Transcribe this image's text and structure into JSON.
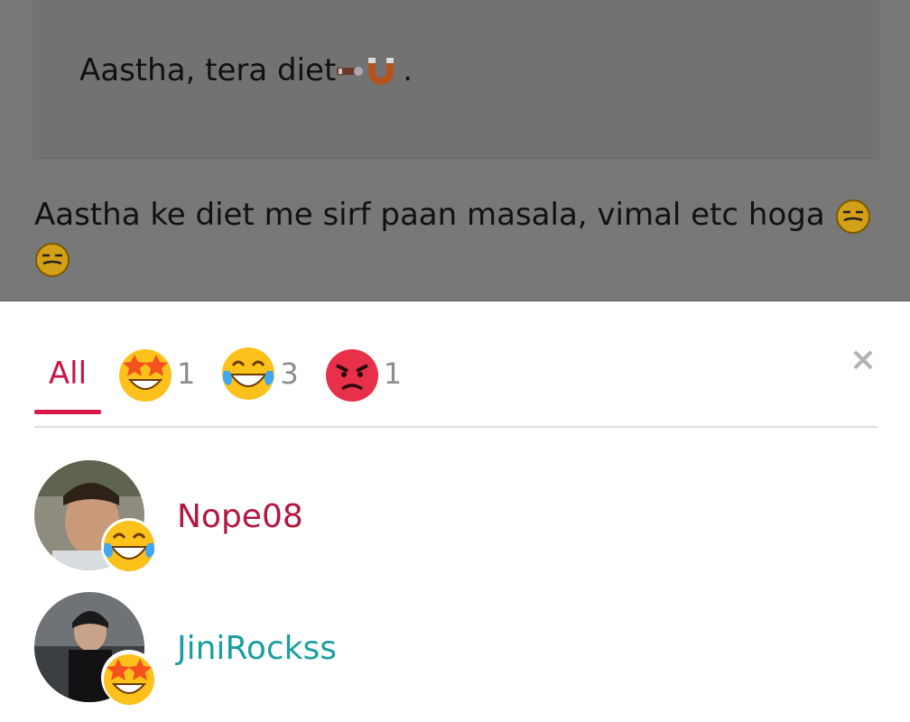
{
  "post": {
    "quote_text": "Aastha, tera diet",
    "quote_suffix": ".",
    "body_text": "Aastha ke diet me sirf paan masala, vimal etc hoga"
  },
  "reactions": {
    "tabs": [
      {
        "label": "All",
        "icon": "all",
        "selected": true
      },
      {
        "icon": "star-struck-emoji",
        "count": "1"
      },
      {
        "icon": "tears-of-joy-emoji",
        "count": "3"
      },
      {
        "icon": "angry-face-emoji",
        "count": "1"
      }
    ],
    "close_icon": "close-icon",
    "close_glyph": "×",
    "users": [
      {
        "name": "Nope08",
        "reaction": "tears-of-joy-emoji",
        "name_color": "#b3163f"
      },
      {
        "name": "JiniRockss",
        "reaction": "star-struck-emoji",
        "name_color": "#1a9ea0"
      }
    ]
  },
  "colors": {
    "accent": "#d8194a",
    "count_gray": "#8c8c8c",
    "overlay": "#787878"
  }
}
